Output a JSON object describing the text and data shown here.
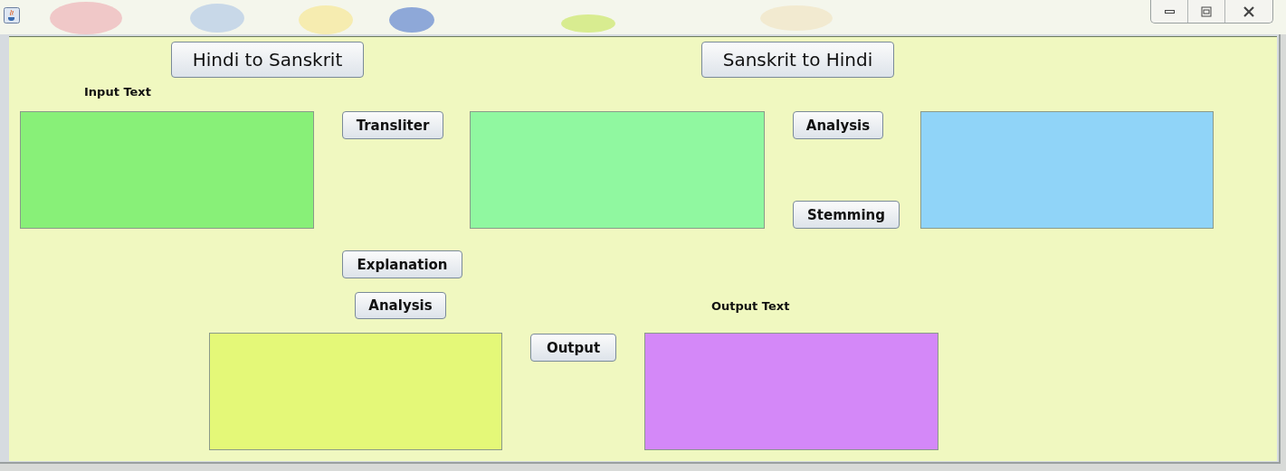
{
  "items": [
    {
      "kind": "large_button",
      "label": "Hindi to Sanskrit"
    },
    {
      "kind": "large_button",
      "label": "Sanskrit to Hindi"
    },
    {
      "kind": "label",
      "label": "Input Text"
    },
    {
      "kind": "textarea",
      "color": "#88f078"
    },
    {
      "kind": "button",
      "label": "Transliter"
    },
    {
      "kind": "textarea",
      "color": "#90f8a0"
    },
    {
      "kind": "button",
      "label": "Analysis"
    },
    {
      "kind": "button",
      "label": "Stemming"
    },
    {
      "kind": "textarea",
      "color": "#90d4f8"
    },
    {
      "kind": "button",
      "label": "Explanation"
    },
    {
      "kind": "button",
      "label": "Analysis"
    },
    {
      "kind": "label",
      "label": "Output Text"
    },
    {
      "kind": "textarea",
      "color": "#e4f878"
    },
    {
      "kind": "button",
      "label": "Output"
    },
    {
      "kind": "textarea",
      "color": "#d488f8"
    }
  ]
}
